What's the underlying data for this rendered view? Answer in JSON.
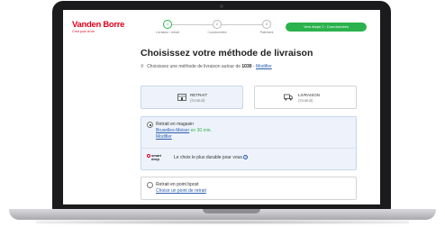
{
  "header": {
    "logo": {
      "name": "Vanden Borre",
      "tagline": "C'est pour la vie"
    },
    "steps": [
      {
        "number": "1",
        "label": "Livraison / retrait"
      },
      {
        "number": "2",
        "label": "Coordonnées"
      },
      {
        "number": "3",
        "label": "Paiement"
      }
    ],
    "next_button": "Vers étape 2 : Coordonnées"
  },
  "main": {
    "title": "Choisissez votre méthode de livraison",
    "subline_prefix": "Choisissez une méthode de livraison autour de",
    "postcode": "1030",
    "modify_link": "Modifier",
    "modes": [
      {
        "icon": "store-icon",
        "label": "RETRAIT",
        "sub": "(Gratuit)",
        "selected": true
      },
      {
        "icon": "truck-icon",
        "label": "LIVRAISON",
        "sub": "(Gratuit)",
        "selected": false
      }
    ],
    "store_option": {
      "title": "Retrait en magasin",
      "store_link": "Bruxelles-Meiser",
      "availability": "en 30 min.",
      "modify_link": "Modifier"
    },
    "smart_drop": {
      "logo_line1": "smart",
      "logo_line2": "drop",
      "text": "Le choix le plus durable pour vous",
      "info": "?"
    },
    "point_option": {
      "title": "Retrait en point bpost",
      "choose_link": "Choisir un point de retrait"
    }
  },
  "colors": {
    "brand": "#e2001a",
    "accent_green": "#2bb24c",
    "link": "#2a5db0",
    "selected_bg": "#eef3fb"
  }
}
